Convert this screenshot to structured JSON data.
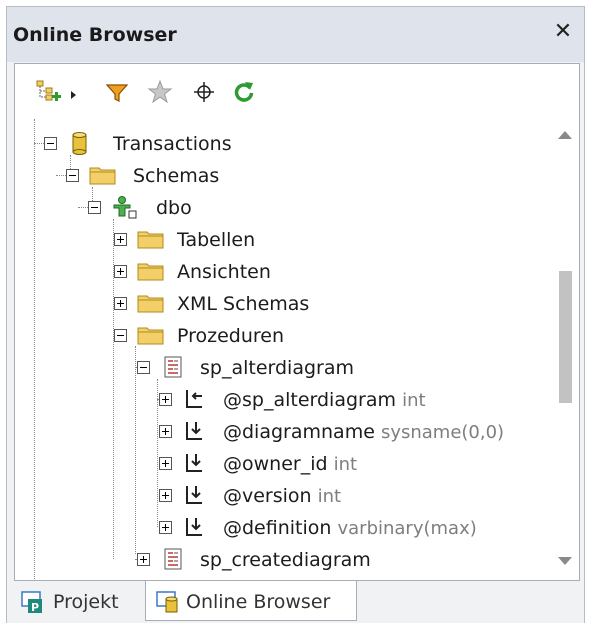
{
  "window": {
    "title": "Online Browser",
    "close_glyph": "✕"
  },
  "toolbar": {
    "icons": [
      "add-datasource-icon",
      "dropdown-arrow-icon",
      "filter-icon",
      "favorites-star-icon",
      "locate-icon",
      "refresh-icon"
    ]
  },
  "tree": {
    "database": "Transactions",
    "schemas": "Schemas",
    "schema": "dbo",
    "folders": [
      "Tabellen",
      "Ansichten",
      "XML Schemas",
      "Prozeduren"
    ],
    "procedure": "sp_alterdiagram",
    "params": [
      {
        "name": "@sp_alterdiagram",
        "type": "int"
      },
      {
        "name": "@diagramname",
        "type": "sysname(0,0)"
      },
      {
        "name": "@owner_id",
        "type": "int"
      },
      {
        "name": "@version",
        "type": "int"
      },
      {
        "name": "@definition",
        "type": "varbinary(max)"
      }
    ],
    "next_procedure": "sp_creatediagram"
  },
  "tabs": [
    {
      "label": "Projekt",
      "active": false
    },
    {
      "label": "Online Browser",
      "active": true
    }
  ],
  "colors": {
    "folder": "#f3cf6a",
    "db": "#e8c23a",
    "green": "#2f9a2f",
    "filter": "#e07b00"
  }
}
